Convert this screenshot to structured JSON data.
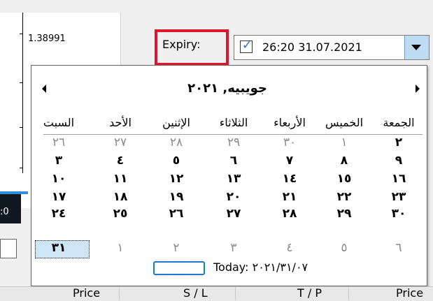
{
  "chart": {
    "price_label": "1.38991",
    "edge_text": ":0"
  },
  "expiry": {
    "label": "Expiry:",
    "date_value": "26:20 31.07.2021",
    "checked_mark": "✓"
  },
  "calendar": {
    "month_title": "جويبيه, ٢٠٢١",
    "weekdays": [
      "الجمعة",
      "الخميس",
      "الأربعاء",
      "الثلاثاء",
      "الإثنين",
      "الأحد",
      "السبت"
    ],
    "rows": [
      [
        {
          "t": "٢",
          "c": true
        },
        {
          "t": "١",
          "c": false
        },
        {
          "t": "٣٠",
          "c": false
        },
        {
          "t": "٢٩",
          "c": false
        },
        {
          "t": "٢٨",
          "c": false
        },
        {
          "t": "٢٧",
          "c": false
        },
        {
          "t": "٢٦",
          "c": false
        }
      ],
      [
        {
          "t": "٩",
          "c": true
        },
        {
          "t": "٨",
          "c": true
        },
        {
          "t": "٧",
          "c": true
        },
        {
          "t": "٦",
          "c": true
        },
        {
          "t": "٥",
          "c": true
        },
        {
          "t": "٤",
          "c": true
        },
        {
          "t": "٣",
          "c": true
        }
      ],
      [
        {
          "t": "١٦",
          "c": true
        },
        {
          "t": "١٥",
          "c": true
        },
        {
          "t": "١٤",
          "c": true
        },
        {
          "t": "١٣",
          "c": true
        },
        {
          "t": "١٢",
          "c": true
        },
        {
          "t": "١١",
          "c": true
        },
        {
          "t": "١٠",
          "c": true
        }
      ],
      [
        {
          "t": "٢٣",
          "c": true
        },
        {
          "t": "٢٢",
          "c": true
        },
        {
          "t": "٢١",
          "c": true
        },
        {
          "t": "٢٠",
          "c": true
        },
        {
          "t": "١٩",
          "c": true
        },
        {
          "t": "١٨",
          "c": true
        },
        {
          "t": "١٧",
          "c": true
        }
      ],
      [
        {
          "t": "٣٠",
          "c": true
        },
        {
          "t": "٢٩",
          "c": true
        },
        {
          "t": "٢٨",
          "c": true
        },
        {
          "t": "٢٧",
          "c": true
        },
        {
          "t": "٢٦",
          "c": true
        },
        {
          "t": "٢٥",
          "c": true
        },
        {
          "t": "٢٤",
          "c": true
        }
      ],
      [
        {
          "t": "٦",
          "c": false
        },
        {
          "t": "٥",
          "c": false
        },
        {
          "t": "٤",
          "c": false
        },
        {
          "t": "٣",
          "c": false
        },
        {
          "t": "٢",
          "c": false
        },
        {
          "t": "١",
          "c": false
        },
        {
          "t": "٣١",
          "c": true,
          "sel": true
        }
      ]
    ],
    "today_text": "Today: ٢٠٢١/٣١/٠٧"
  },
  "columns": [
    "Price",
    "S / L",
    "T / P",
    "Price"
  ],
  "colors": {
    "highlight": "#e0162b",
    "selection": "#cfe6f8",
    "accent": "#1b78d2"
  }
}
